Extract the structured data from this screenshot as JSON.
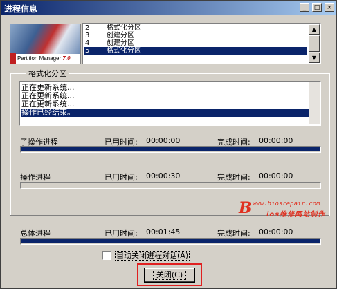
{
  "window": {
    "title": "进程信息",
    "controls": {
      "minimize": "_",
      "maximize": "□",
      "close": "×"
    }
  },
  "banner": {
    "product": "Partition Manager",
    "version": "7.0"
  },
  "operations": {
    "rows": [
      {
        "num": "2",
        "text": "格式化分区",
        "selected": false
      },
      {
        "num": "3",
        "text": "创建分区",
        "selected": false
      },
      {
        "num": "4",
        "text": "创建分区",
        "selected": false
      },
      {
        "num": "5",
        "text": "格式化分区",
        "selected": true
      }
    ],
    "scroll_up": "▲",
    "scroll_down": "▼"
  },
  "current_group": {
    "label": "格式化分区",
    "log": [
      {
        "text": "正在更新系统...",
        "selected": false
      },
      {
        "text": "正在更新系统...",
        "selected": false
      },
      {
        "text": "正在更新系统...",
        "selected": false
      },
      {
        "text": "操作已经结束。",
        "selected": true
      }
    ],
    "sub_progress": {
      "label": "子操作进程",
      "elapsed_label": "已用时间:",
      "elapsed": "00:00:00",
      "finish_label": "完成时间:",
      "finish": "00:00:00",
      "percent": 100
    },
    "op_progress": {
      "label": "操作进程",
      "elapsed_label": "已用时间:",
      "elapsed": "00:00:30",
      "finish_label": "完成时间:",
      "finish": "00:00:00",
      "percent": 0
    }
  },
  "total_progress": {
    "label": "总体进程",
    "elapsed_label": "已用时间:",
    "elapsed": "00:01:45",
    "finish_label": "完成时间:",
    "finish": "00:00:00",
    "percent": 100
  },
  "auto_close": {
    "label": "自动关闭进程对话(A)",
    "checked": false
  },
  "close_button": {
    "label": "关闭(C)"
  },
  "watermark": {
    "logo": "B",
    "url": "www.biosrepair.com",
    "name": "ios维修网站制作"
  },
  "colors": {
    "selection": "#0a246a",
    "progress_fill": "#0a246a",
    "highlight": "#e02020"
  }
}
